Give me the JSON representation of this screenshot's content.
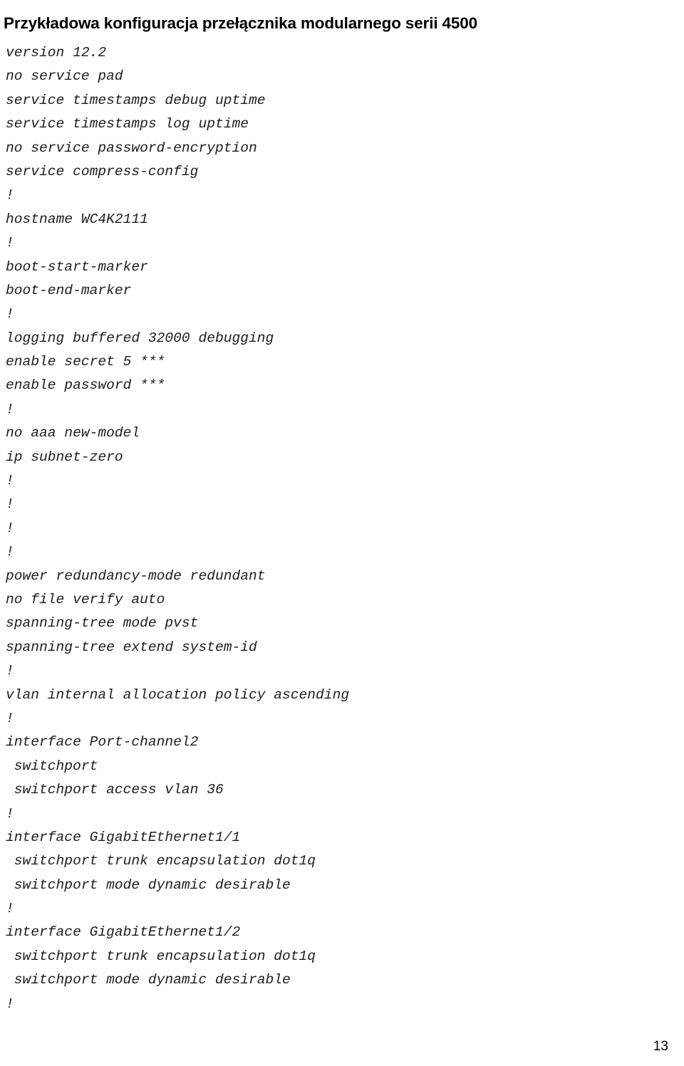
{
  "document": {
    "title": "Przykładowa konfiguracja przełącznika modularnego serii 4500",
    "page_number": "13",
    "text_color": "#1d1d1d",
    "background_color": "#ffffff"
  },
  "code_listing": {
    "lines": [
      "version 12.2",
      "no service pad",
      "service timestamps debug uptime",
      "service timestamps log uptime",
      "no service password-encryption",
      "service compress-config",
      "!",
      "hostname WC4K2111",
      "!",
      "boot-start-marker",
      "boot-end-marker",
      "!",
      "logging buffered 32000 debugging",
      "enable secret 5 ***",
      "enable password ***",
      "!",
      "no aaa new-model",
      "ip subnet-zero",
      "!",
      "!",
      "!",
      "!",
      "power redundancy-mode redundant",
      "no file verify auto",
      "spanning-tree mode pvst",
      "spanning-tree extend system-id",
      "!",
      "vlan internal allocation policy ascending",
      "!",
      "interface Port-channel2",
      " switchport",
      " switchport access vlan 36",
      "!",
      "interface GigabitEthernet1/1",
      " switchport trunk encapsulation dot1q",
      " switchport mode dynamic desirable",
      "!",
      "interface GigabitEthernet1/2",
      " switchport trunk encapsulation dot1q",
      " switchport mode dynamic desirable",
      "!"
    ]
  }
}
